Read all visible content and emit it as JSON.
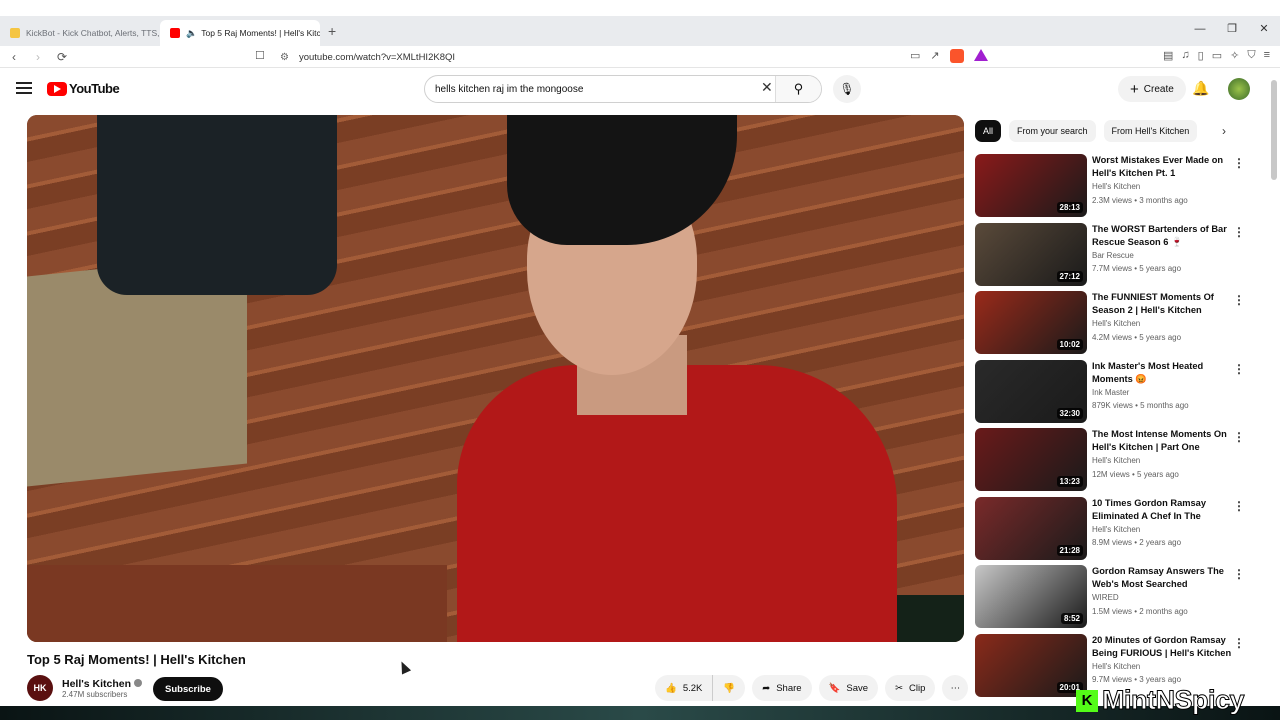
{
  "browser": {
    "tabs": [
      {
        "label": "KickBot - Kick Chatbot, Alerts, TTS, C",
        "active": false
      },
      {
        "label": "Top 5 Raj Moments! | Hell's Kitchen",
        "active": true
      }
    ],
    "url": "youtube.com/watch?v=XMLtHI2K8QI"
  },
  "header": {
    "logo_text": "YouTube",
    "search_query": "hells kitchen raj im the mongoose",
    "create_label": "Create"
  },
  "video": {
    "title": "Top 5 Raj Moments! | Hell's Kitchen",
    "channel": "Hell's Kitchen",
    "channel_initials": "HK",
    "subscribers": "2.47M subscribers",
    "subscribe_label": "Subscribe",
    "likes": "5.2K",
    "share_label": "Share",
    "save_label": "Save",
    "clip_label": "Clip"
  },
  "sidebar": {
    "chips": [
      "All",
      "From your search",
      "From Hell's Kitchen"
    ],
    "recommendations": [
      {
        "title": "Worst Mistakes Ever Made on Hell's Kitchen Pt. 1",
        "channel": "Hell's Kitchen",
        "meta": "2.3M views • 3 months ago",
        "duration": "28:13",
        "thumb_color": "#8a1a1a"
      },
      {
        "title": "The WORST Bartenders of Bar Rescue Season 6 🍷",
        "channel": "Bar Rescue",
        "meta": "7.7M views • 5 years ago",
        "duration": "27:12",
        "thumb_color": "#5a4a3a"
      },
      {
        "title": "The FUNNIEST Moments Of Season 2 | Hell's Kitchen",
        "channel": "Hell's Kitchen",
        "meta": "4.2M views • 5 years ago",
        "duration": "10:02",
        "thumb_color": "#9a2a1a"
      },
      {
        "title": "Ink Master's Most Heated Moments 😡",
        "channel": "Ink Master",
        "meta": "879K views • 5 months ago",
        "duration": "32:30",
        "thumb_color": "#2a2a2a"
      },
      {
        "title": "The Most Intense Moments On Hell's Kitchen | Part One",
        "channel": "Hell's Kitchen",
        "meta": "12M views • 5 years ago",
        "duration": "13:23",
        "thumb_color": "#6a1a1a"
      },
      {
        "title": "10 Times Gordon Ramsay Eliminated A Chef In The Midd…",
        "channel": "Hell's Kitchen",
        "meta": "8.9M views • 2 years ago",
        "duration": "21:28",
        "thumb_color": "#7a2a2a"
      },
      {
        "title": "Gordon Ramsay Answers The Web's Most Searched Questio…",
        "channel": "WIRED",
        "meta": "1.5M views • 2 months ago",
        "duration": "8:52",
        "thumb_color": "#c8c8c8"
      },
      {
        "title": "20 Minutes of Gordon Ramsay Being FURIOUS | Hell's Kitchen",
        "channel": "Hell's Kitchen",
        "meta": "9.7M views • 3 years ago",
        "duration": "20:01",
        "thumb_color": "#8a2a1a"
      }
    ]
  },
  "watermark": {
    "letter": "K",
    "text": "MintNSpicy"
  }
}
